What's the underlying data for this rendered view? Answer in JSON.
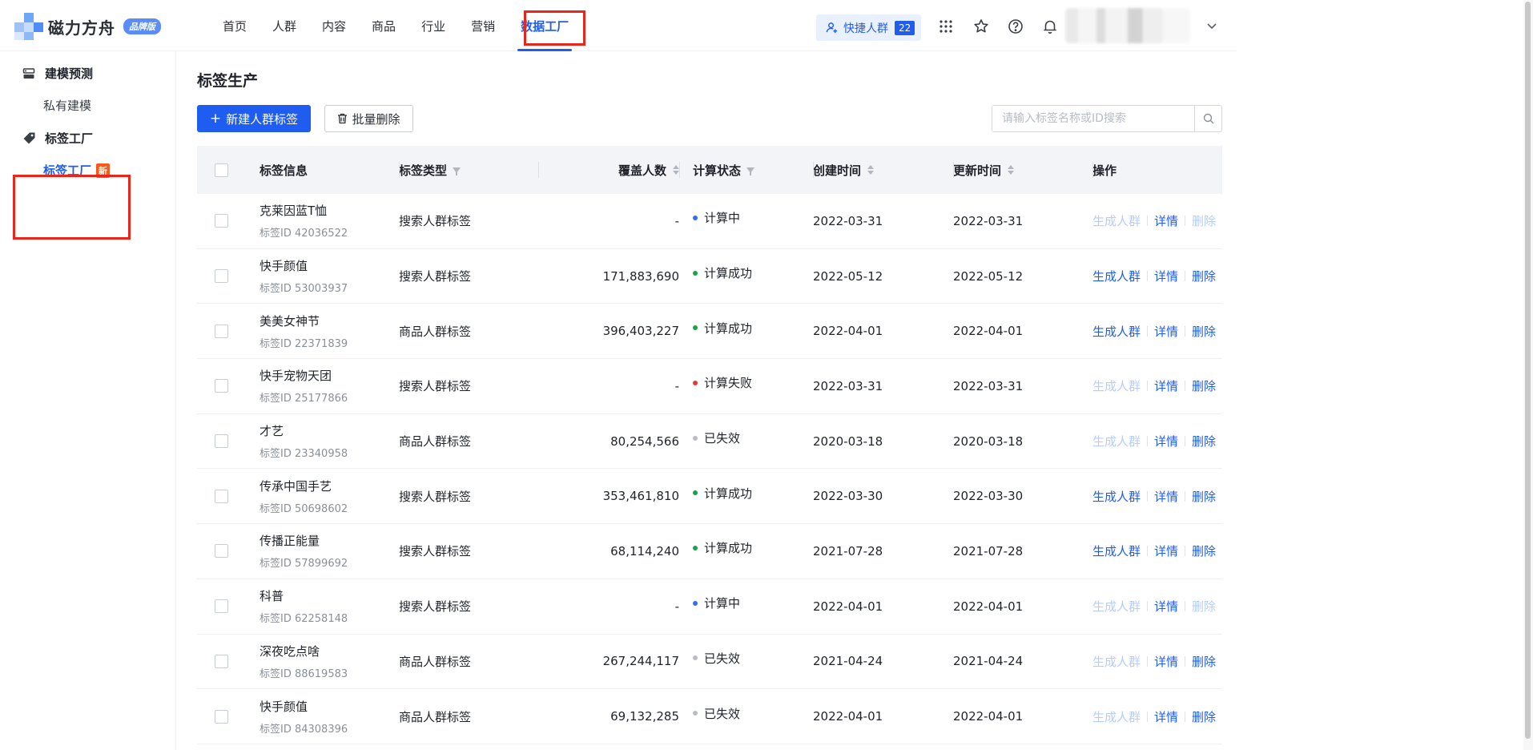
{
  "brand": {
    "name": "磁力方舟",
    "badge": "品牌版"
  },
  "nav": {
    "items": [
      "首页",
      "人群",
      "内容",
      "商品",
      "行业",
      "营销",
      "数据工厂"
    ],
    "active_index": 6
  },
  "header": {
    "quick_label": "快捷人群",
    "quick_count": "22",
    "icons": [
      "apps-grid-icon",
      "star-icon",
      "help-icon",
      "bell-icon",
      "chevron-down-icon"
    ]
  },
  "sidebar": {
    "groups": [
      {
        "label": "建模预测",
        "icon": "model-icon",
        "items": [
          {
            "label": "私有建模",
            "active": false
          }
        ]
      },
      {
        "label": "标签工厂",
        "icon": "tag-icon",
        "items": [
          {
            "label": "标签工厂",
            "active": true,
            "badge": "新"
          }
        ]
      }
    ]
  },
  "main": {
    "title": "标签生产",
    "new_button": "新建人群标签",
    "batch_delete_button": "批量删除",
    "search_placeholder": "请输入标签名称或ID搜索"
  },
  "table": {
    "columns": [
      "标签信息",
      "标签类型",
      "覆盖人数",
      "计算状态",
      "创建时间",
      "更新时间",
      "操作"
    ],
    "ops": [
      "生成人群",
      "详情",
      "删除"
    ],
    "id_prefix": "标签ID",
    "status_colors": {
      "计算中": "#2f6ef5",
      "计算成功": "#16a34a",
      "计算失败": "#e53935",
      "已失效": "#b8bcc4"
    },
    "rows": [
      {
        "name": "克莱因蓝T恤",
        "id": "标签ID 42036522",
        "type": "搜索人群标签",
        "cover": "-",
        "status": "计算中",
        "created": "2022-03-31",
        "updated": "2022-03-31",
        "ops_enabled": [
          false,
          true,
          false
        ]
      },
      {
        "name": "快手颜值",
        "id": "标签ID 53003937",
        "type": "搜索人群标签",
        "cover": "171,883,690",
        "status": "计算成功",
        "created": "2022-05-12",
        "updated": "2022-05-12",
        "ops_enabled": [
          true,
          true,
          true
        ]
      },
      {
        "name": "美美女神节",
        "id": "标签ID 22371839",
        "type": "商品人群标签",
        "cover": "396,403,227",
        "status": "计算成功",
        "created": "2022-04-01",
        "updated": "2022-04-01",
        "ops_enabled": [
          true,
          true,
          true
        ]
      },
      {
        "name": "快手宠物天团",
        "id": "标签ID 25177866",
        "type": "搜索人群标签",
        "cover": "-",
        "status": "计算失败",
        "created": "2022-03-31",
        "updated": "2022-03-31",
        "ops_enabled": [
          false,
          true,
          true
        ]
      },
      {
        "name": "才艺",
        "id": "标签ID 23340958",
        "type": "商品人群标签",
        "cover": "80,254,566",
        "status": "已失效",
        "created": "2020-03-18",
        "updated": "2020-03-18",
        "ops_enabled": [
          false,
          true,
          true
        ]
      },
      {
        "name": "传承中国手艺",
        "id": "标签ID 50698602",
        "type": "搜索人群标签",
        "cover": "353,461,810",
        "status": "计算成功",
        "created": "2022-03-30",
        "updated": "2022-03-30",
        "ops_enabled": [
          true,
          true,
          true
        ]
      },
      {
        "name": "传播正能量",
        "id": "标签ID 57899692",
        "type": "搜索人群标签",
        "cover": "68,114,240",
        "status": "计算成功",
        "created": "2021-07-28",
        "updated": "2021-07-28",
        "ops_enabled": [
          true,
          true,
          true
        ]
      },
      {
        "name": "科普",
        "id": "标签ID 62258148",
        "type": "搜索人群标签",
        "cover": "-",
        "status": "计算中",
        "created": "2022-04-01",
        "updated": "2022-04-01",
        "ops_enabled": [
          false,
          true,
          false
        ]
      },
      {
        "name": "深夜吃点啥",
        "id": "标签ID 88619583",
        "type": "商品人群标签",
        "cover": "267,244,117",
        "status": "已失效",
        "created": "2021-04-24",
        "updated": "2021-04-24",
        "ops_enabled": [
          false,
          true,
          true
        ]
      },
      {
        "name": "快手颜值",
        "id": "标签ID 84308396",
        "type": "商品人群标签",
        "cover": "69,132,285",
        "status": "已失效",
        "created": "2022-04-01",
        "updated": "2022-04-01",
        "ops_enabled": [
          false,
          true,
          true
        ]
      }
    ]
  }
}
